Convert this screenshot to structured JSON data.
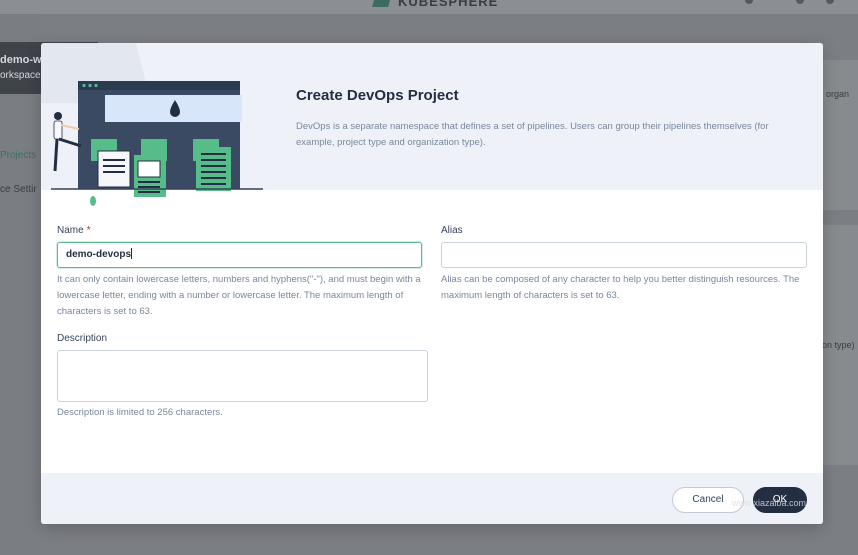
{
  "background": {
    "brand": "KUBESPHERE",
    "workspace_name": "demo-wor",
    "workspace_type": "orkspace",
    "nav_projects": "Projects",
    "nav_settings": "ce Settir",
    "right_text_1": "organ",
    "right_text_2": "on type)"
  },
  "modal": {
    "title": "Create DevOps Project",
    "description": "DevOps is a separate namespace that defines a set of pipelines. Users can group their pipelines themselves (for example, project type and organization type).",
    "name_label": "Name",
    "name_required": "*",
    "name_value": "demo-devops",
    "name_hint": "It can only contain lowercase letters, numbers and hyphens(\"-\"), and must begin with a lowercase letter, ending with a number or lowercase letter. The maximum length of characters is set to 63.",
    "alias_label": "Alias",
    "alias_value": "",
    "alias_hint": "Alias can be composed of any character to help you better distinguish resources. The maximum length of characters is set to 63.",
    "description_label": "Description",
    "description_value": "",
    "description_hint": "Description is limited to 256 characters.",
    "cancel_label": "Cancel",
    "ok_label": "OK"
  },
  "watermark": "www.xiazaiba.com",
  "colors": {
    "accent": "#55bc8a",
    "dark": "#242e42",
    "required": "#ca2621"
  }
}
